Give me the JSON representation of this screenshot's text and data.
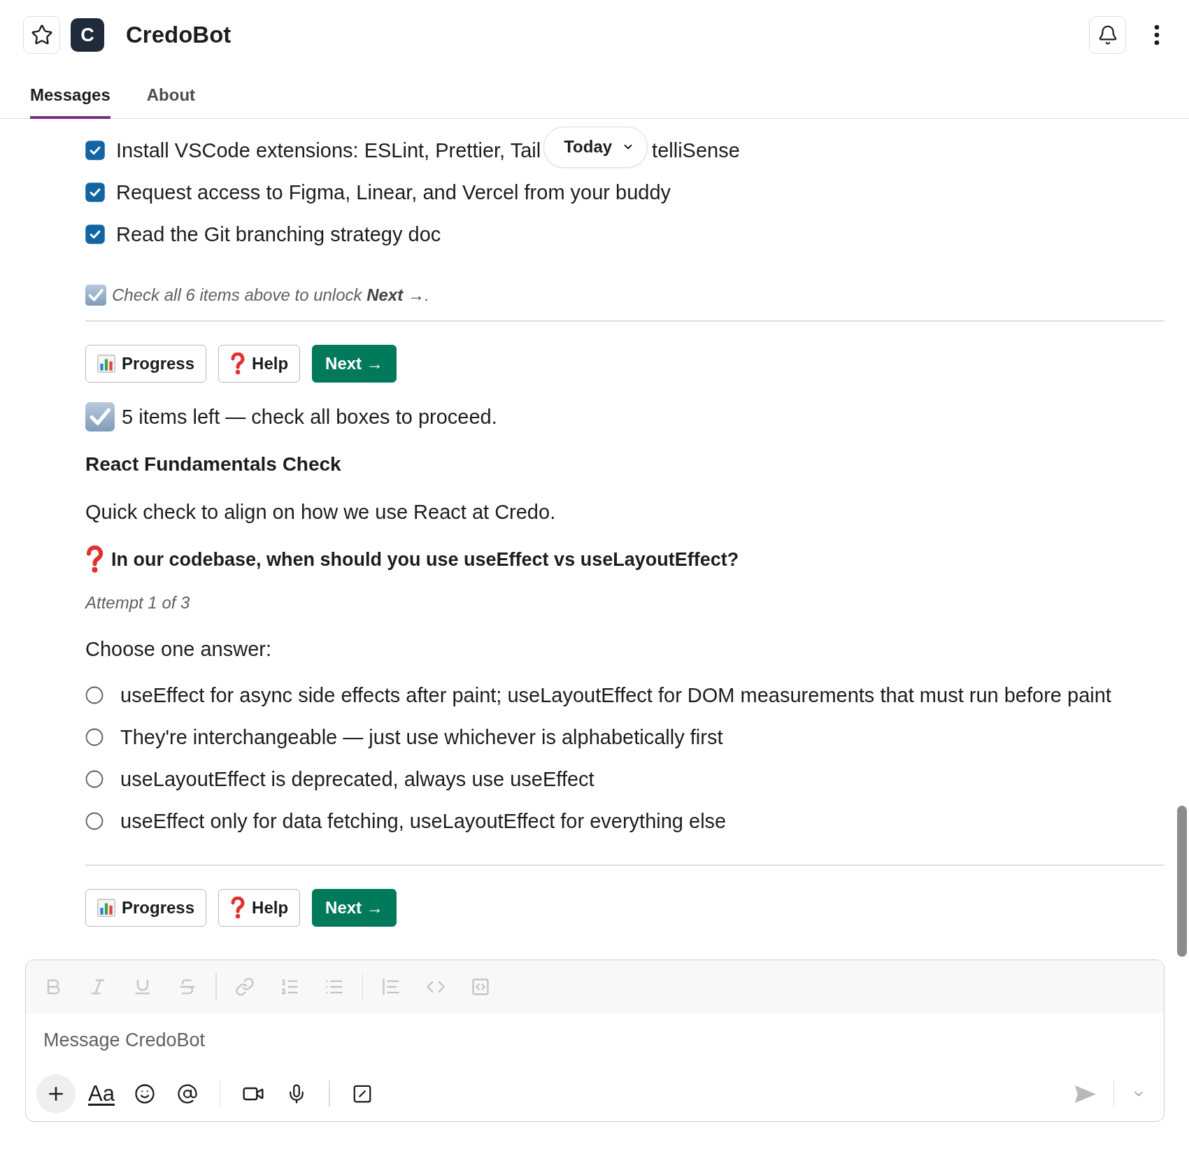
{
  "header": {
    "avatar_letter": "C",
    "title": "CredoBot"
  },
  "tabs": [
    {
      "label": "Messages",
      "selected": true
    },
    {
      "label": "About",
      "selected": false
    }
  ],
  "date_divider": {
    "label": "Today"
  },
  "checklist_message": {
    "items": [
      {
        "label": "Install VSCode extensions: ESLint, Prettier, Tail",
        "label_after_divider": "telliSense",
        "checked": true
      },
      {
        "label": "Request access to Figma, Linear, and Vercel from your buddy",
        "checked": true
      },
      {
        "label": "Read the Git branching strategy doc",
        "checked": true
      }
    ],
    "note": "Check all 6 items above to unlock **Next →**.",
    "actions": [
      {
        "kind": "chart",
        "label": "Progress"
      },
      {
        "kind": "help",
        "label": "Help"
      },
      {
        "kind": "primary",
        "label": "Next →"
      }
    ]
  },
  "status_line": "5 items left — check all boxes to proceed.",
  "quiz": {
    "title": "React Fundamentals Check",
    "intro": "Quick check to align on how we use React at Credo.",
    "question": "In our codebase, when should you use useEffect vs useLayoutEffect?",
    "attempt": "Attempt 1 of 3",
    "prompt": "Choose one answer:",
    "options": [
      {
        "label": "useEffect for async side effects after paint; useLayoutEffect for DOM measurements that must run before paint",
        "selected": false
      },
      {
        "label": "They're interchangeable — just use whichever is alphabetically first",
        "selected": false
      },
      {
        "label": "useLayoutEffect is deprecated, always use useEffect",
        "selected": false
      },
      {
        "label": "useEffect only for data fetching, useLayoutEffect for everything else",
        "selected": false
      }
    ],
    "actions": [
      {
        "kind": "chart",
        "label": "Progress"
      },
      {
        "kind": "help",
        "label": "Help"
      },
      {
        "kind": "primary",
        "label": "Next →"
      }
    ]
  },
  "composer": {
    "placeholder": "Message CredoBot",
    "format_label": "Aa",
    "formatting_disabled": true,
    "send_disabled": true
  }
}
